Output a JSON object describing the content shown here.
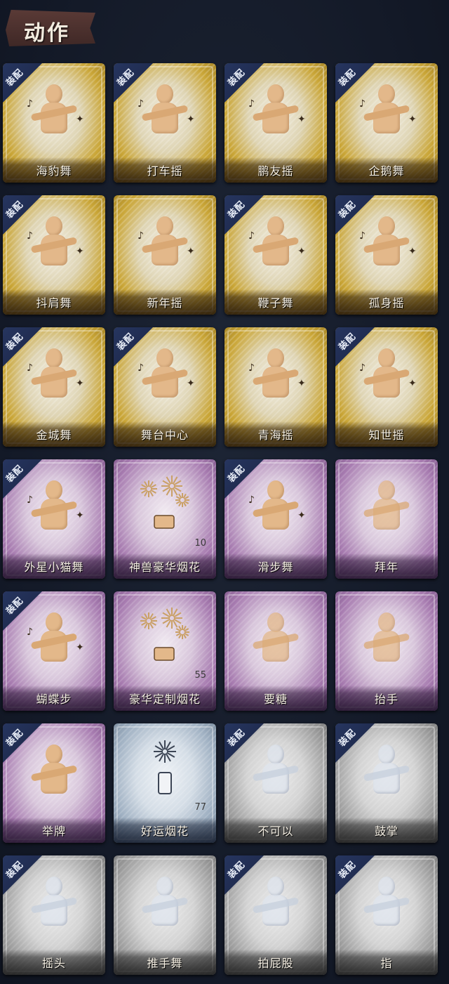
{
  "header": {
    "title": "动作"
  },
  "equip_label": "装配",
  "cards": [
    {
      "name": "海豹舞",
      "tier": "gold",
      "equipped": true,
      "kind": "dance"
    },
    {
      "name": "打车摇",
      "tier": "gold",
      "equipped": true,
      "kind": "dance"
    },
    {
      "name": "鹏友摇",
      "tier": "gold",
      "equipped": true,
      "kind": "dance"
    },
    {
      "name": "企鹅舞",
      "tier": "gold",
      "equipped": true,
      "kind": "dance"
    },
    {
      "name": "抖肩舞",
      "tier": "gold",
      "equipped": true,
      "kind": "dance"
    },
    {
      "name": "新年摇",
      "tier": "gold",
      "equipped": false,
      "kind": "dance"
    },
    {
      "name": "鞭子舞",
      "tier": "gold",
      "equipped": true,
      "kind": "dance"
    },
    {
      "name": "孤身摇",
      "tier": "gold",
      "equipped": true,
      "kind": "dance"
    },
    {
      "name": "金城舞",
      "tier": "gold",
      "equipped": true,
      "kind": "dance"
    },
    {
      "name": "舞台中心",
      "tier": "gold",
      "equipped": true,
      "kind": "dance"
    },
    {
      "name": "青海摇",
      "tier": "gold",
      "equipped": false,
      "kind": "dance"
    },
    {
      "name": "知世摇",
      "tier": "gold",
      "equipped": true,
      "kind": "dance"
    },
    {
      "name": "外星小猫舞",
      "tier": "purple",
      "equipped": true,
      "kind": "dance"
    },
    {
      "name": "神兽豪华烟花",
      "tier": "purple",
      "equipped": false,
      "kind": "firework",
      "count": "10"
    },
    {
      "name": "滑步舞",
      "tier": "purple",
      "equipped": true,
      "kind": "dance"
    },
    {
      "name": "拜年",
      "tier": "purple",
      "equipped": false,
      "kind": "ghost"
    },
    {
      "name": "蝴蝶步",
      "tier": "purple",
      "equipped": true,
      "kind": "dance"
    },
    {
      "name": "豪华定制烟花",
      "tier": "purple",
      "equipped": false,
      "kind": "firework",
      "count": "55"
    },
    {
      "name": "要糖",
      "tier": "purple",
      "equipped": false,
      "kind": "ghost"
    },
    {
      "name": "抬手",
      "tier": "purple",
      "equipped": false,
      "kind": "ghost"
    },
    {
      "name": "举牌",
      "tier": "purple",
      "equipped": true,
      "kind": "sign"
    },
    {
      "name": "好运烟花",
      "tier": "blue",
      "equipped": false,
      "kind": "firework",
      "count": "77"
    },
    {
      "name": "不可以",
      "tier": "gray",
      "equipped": true,
      "kind": "ghost"
    },
    {
      "name": "鼓掌",
      "tier": "gray",
      "equipped": true,
      "kind": "ghost"
    },
    {
      "name": "摇头",
      "tier": "gray",
      "equipped": true,
      "kind": "ghost"
    },
    {
      "name": "推手舞",
      "tier": "gray",
      "equipped": false,
      "kind": "ghost"
    },
    {
      "name": "拍屁股",
      "tier": "gray",
      "equipped": true,
      "kind": "ghost"
    },
    {
      "name": "指",
      "tier": "gray",
      "equipped": true,
      "kind": "ghost"
    }
  ]
}
